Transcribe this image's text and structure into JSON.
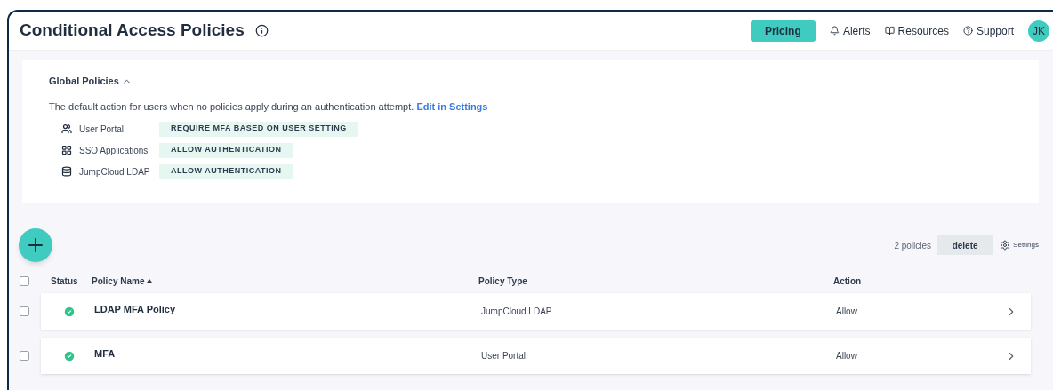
{
  "header": {
    "title": "Conditional Access Policies",
    "pricing": "Pricing",
    "links": [
      {
        "kind": "bell",
        "label": "Alerts"
      },
      {
        "kind": "book",
        "label": "Resources"
      },
      {
        "kind": "help",
        "label": "Support"
      }
    ],
    "avatar": "JK"
  },
  "global_policies": {
    "title": "Global Policies",
    "expanded": true,
    "description": "The default action for users when no policies apply during an authentication attempt.",
    "link": "Edit in Settings",
    "items": [
      {
        "kind": "user-portal",
        "name": "User Portal",
        "action": "REQUIRE MFA BASED ON USER SETTING"
      },
      {
        "kind": "sso",
        "name": "SSO Applications",
        "action": "ALLOW AUTHENTICATION"
      },
      {
        "kind": "ldap",
        "name": "JumpCloud LDAP",
        "action": "ALLOW AUTHENTICATION"
      }
    ]
  },
  "toolbar": {
    "count": "2 policies",
    "delete": "delete",
    "settings": "Settings"
  },
  "table": {
    "select_all": {
      "checked": false
    },
    "columns": [
      "Status",
      "Policy Name",
      "Policy Type",
      "Action"
    ],
    "rows": [
      {
        "checked": false,
        "active": true,
        "name": "LDAP MFA Policy",
        "type": "JumpCloud LDAP",
        "action": "Allow"
      },
      {
        "checked": false,
        "active": true,
        "name": "MFA",
        "type": "User Portal",
        "action": "Allow"
      }
    ]
  }
}
